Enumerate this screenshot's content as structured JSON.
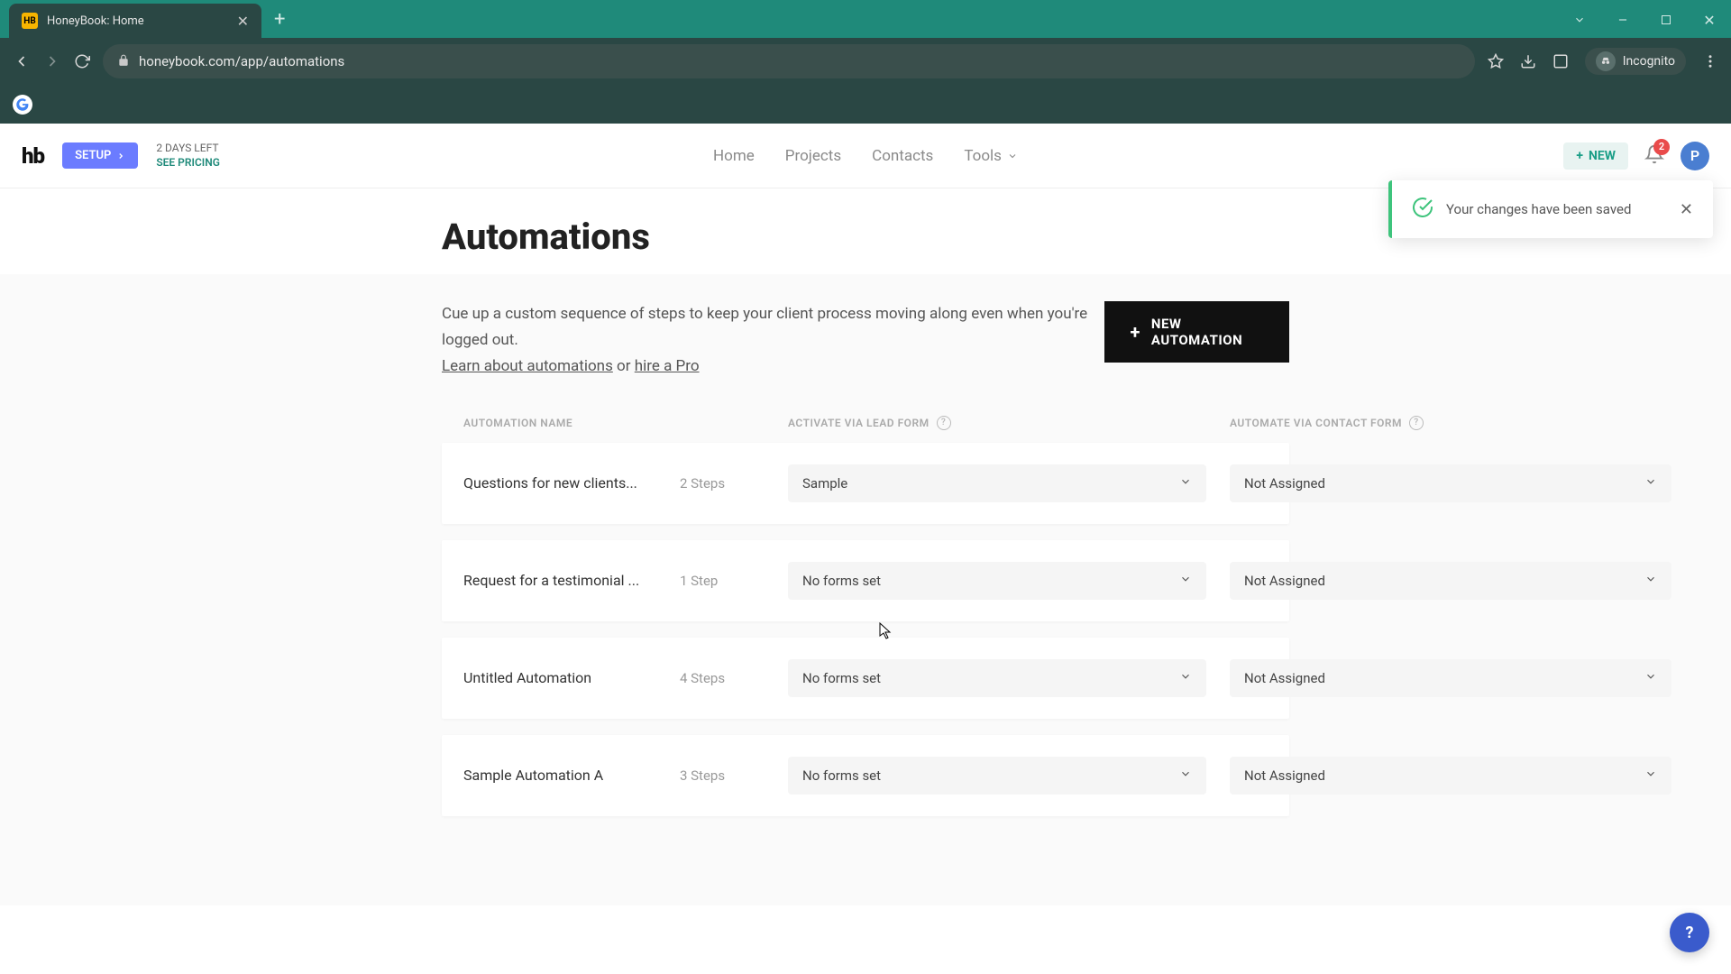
{
  "browser": {
    "tab_title": "HoneyBook: Home",
    "url": "honeybook.com/app/automations",
    "incognito_label": "Incognito",
    "favicon_text": "HB"
  },
  "header": {
    "logo": "hb",
    "setup_label": "SETUP",
    "trial_days": "2 DAYS LEFT",
    "trial_link": "SEE PRICING",
    "nav": {
      "home": "Home",
      "projects": "Projects",
      "contacts": "Contacts",
      "tools": "Tools"
    },
    "new_label": "NEW",
    "notif_count": "2",
    "avatar_letter": "P"
  },
  "toast": {
    "message": "Your changes have been saved"
  },
  "page": {
    "title": "Automations",
    "subhead": "Cue up a custom sequence of steps to keep your client process moving along even when you're logged out.",
    "learn_link": "Learn about automations",
    "or_text": " or ",
    "hire_link": "hire a Pro",
    "new_automation_label": "NEW AUTOMATION"
  },
  "table": {
    "col_name": "AUTOMATION NAME",
    "col_lead": "ACTIVATE VIA LEAD FORM",
    "col_contact": "AUTOMATE VIA CONTACT FORM",
    "rows": [
      {
        "name": "Questions for new clients...",
        "steps": "2 Steps",
        "lead": "Sample",
        "contact": "Not Assigned"
      },
      {
        "name": "Request for a testimonial ...",
        "steps": "1 Step",
        "lead": "No forms set",
        "contact": "Not Assigned"
      },
      {
        "name": "Untitled Automation",
        "steps": "4 Steps",
        "lead": "No forms set",
        "contact": "Not Assigned"
      },
      {
        "name": "Sample Automation A",
        "steps": "3 Steps",
        "lead": "No forms set",
        "contact": "Not Assigned"
      }
    ]
  }
}
